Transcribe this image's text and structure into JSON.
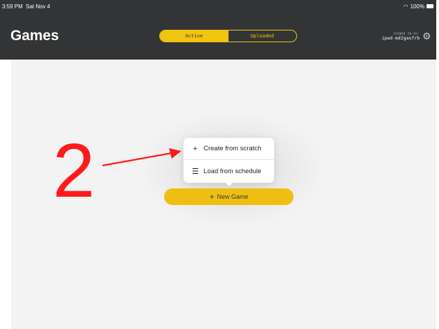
{
  "status_bar": {
    "time": "3:59 PM",
    "date": "Sat Nov 4",
    "battery": "100%",
    "wifi_icon": "wifi-icon",
    "battery_icon": "battery-icon"
  },
  "header": {
    "title": "Games",
    "tabs": [
      {
        "label": "Active",
        "selected": true
      },
      {
        "label": "Uploaded",
        "selected": false
      }
    ],
    "signed_in_label": "SIGNED IN AS:",
    "signed_in_user": "ipad-md2gasfrb",
    "settings_icon": "gear-icon"
  },
  "menu": {
    "items": [
      {
        "label": "Create from scratch",
        "icon": "plus-icon"
      },
      {
        "label": "Load from schedule",
        "icon": "list-icon"
      }
    ]
  },
  "new_game_button": {
    "label": "New Game",
    "icon": "plus-icon"
  },
  "annotation": {
    "number": "2"
  },
  "colors": {
    "header_bg": "#333436",
    "accent": "#f1c40f",
    "annotation": "#ff1a1a"
  }
}
